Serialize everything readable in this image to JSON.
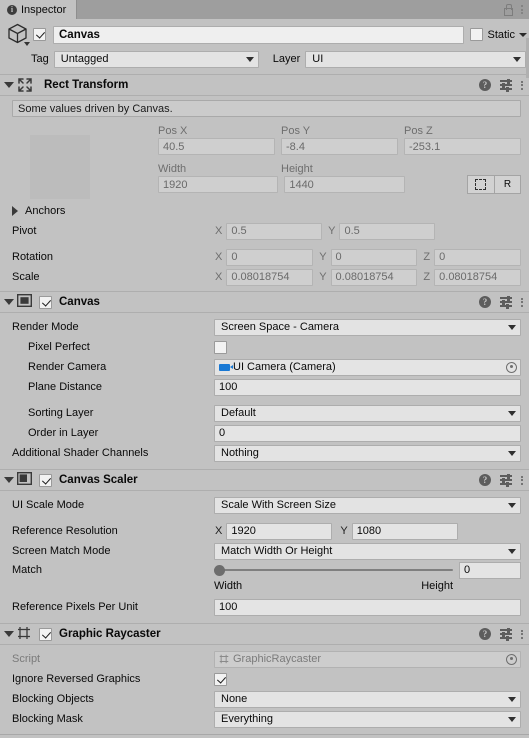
{
  "window": {
    "tab_label": "Inspector",
    "tab_icon": "info-icon",
    "lock_icon": "lock-icon",
    "menu_icon": "kebab-menu-icon"
  },
  "object_header": {
    "enabled_checkbox": true,
    "name": "Canvas",
    "static_label": "Static",
    "static_checked": false,
    "tag_label": "Tag",
    "tag_value": "Untagged",
    "layer_label": "Layer",
    "layer_value": "UI",
    "prefab_icon": "cube-icon"
  },
  "components": [
    {
      "title": "Rect Transform",
      "icon": "rect-transform-icon",
      "has_enable_checkbox": false,
      "expanded": true,
      "helpbox": "Some values driven by Canvas.",
      "columns": [
        "Pos X",
        "Pos Y",
        "Pos Z"
      ],
      "pos": {
        "x": "40.5",
        "y": "-8.4",
        "z": "-253.1"
      },
      "size_columns": [
        "Width",
        "Height"
      ],
      "size": {
        "width": "1920",
        "height": "1440"
      },
      "anchor_preset_button": "anchor-preset-icon",
      "blueprint_button": "R",
      "anchors_label": "Anchors",
      "anchors_expanded": false,
      "pivot_label": "Pivot",
      "pivot": {
        "x": "0.5",
        "y": "0.5"
      },
      "rotation_label": "Rotation",
      "rotation": {
        "x": "0",
        "y": "0",
        "z": "0"
      },
      "scale_label": "Scale",
      "scale": {
        "x": "0.08018754",
        "y": "0.08018754",
        "z": "0.08018754"
      },
      "axis_labels": {
        "x": "X",
        "y": "Y",
        "z": "Z"
      }
    },
    {
      "title": "Canvas",
      "icon": "canvas-icon",
      "has_enable_checkbox": true,
      "enabled": true,
      "expanded": true,
      "rows": [
        {
          "label": "Render Mode",
          "type": "dropdown",
          "value": "Screen Space - Camera"
        },
        {
          "label": "Pixel Perfect",
          "type": "checkbox",
          "value": false,
          "indent": true
        },
        {
          "label": "Render Camera",
          "type": "object",
          "value": "UI Camera (Camera)",
          "icon": "camera-icon",
          "indent": true
        },
        {
          "label": "Plane Distance",
          "type": "text",
          "value": "100",
          "indent": true
        },
        {
          "label": "Sorting Layer",
          "type": "dropdown",
          "value": "Default",
          "indent": true
        },
        {
          "label": "Order in Layer",
          "type": "text",
          "value": "0",
          "indent": true
        },
        {
          "label": "Additional Shader Channels",
          "type": "dropdown",
          "value": "Nothing"
        }
      ]
    },
    {
      "title": "Canvas Scaler",
      "icon": "canvas-scaler-icon",
      "has_enable_checkbox": true,
      "enabled": true,
      "expanded": true,
      "rows": [
        {
          "label": "UI Scale Mode",
          "type": "dropdown",
          "value": "Scale With Screen Size"
        },
        {
          "label": "Reference Resolution",
          "type": "vector2",
          "x": "1920",
          "y": "1080"
        },
        {
          "label": "Screen Match Mode",
          "type": "dropdown",
          "value": "Match Width Or Height"
        },
        {
          "label": "Match",
          "type": "slider",
          "value": "0",
          "min_label": "Width",
          "max_label": "Height"
        },
        {
          "label": "Reference Pixels Per Unit",
          "type": "text",
          "value": "100"
        }
      ]
    },
    {
      "title": "Graphic Raycaster",
      "icon": "graphic-raycaster-icon",
      "has_enable_checkbox": true,
      "enabled": true,
      "expanded": true,
      "rows": [
        {
          "label": "Script",
          "type": "object-disabled",
          "value": "GraphicRaycaster",
          "icon": "script-icon"
        },
        {
          "label": "Ignore Reversed Graphics",
          "type": "checkbox",
          "value": true
        },
        {
          "label": "Blocking Objects",
          "type": "dropdown",
          "value": "None"
        },
        {
          "label": "Blocking Mask",
          "type": "dropdown",
          "value": "Everything"
        }
      ]
    }
  ],
  "colors": {
    "background": "#c2c2c2",
    "field": "#e4e4e4",
    "driven_field": "#cfcfcf",
    "tabbar": "#9e9e9e",
    "accent_camera": "#1878d4"
  }
}
